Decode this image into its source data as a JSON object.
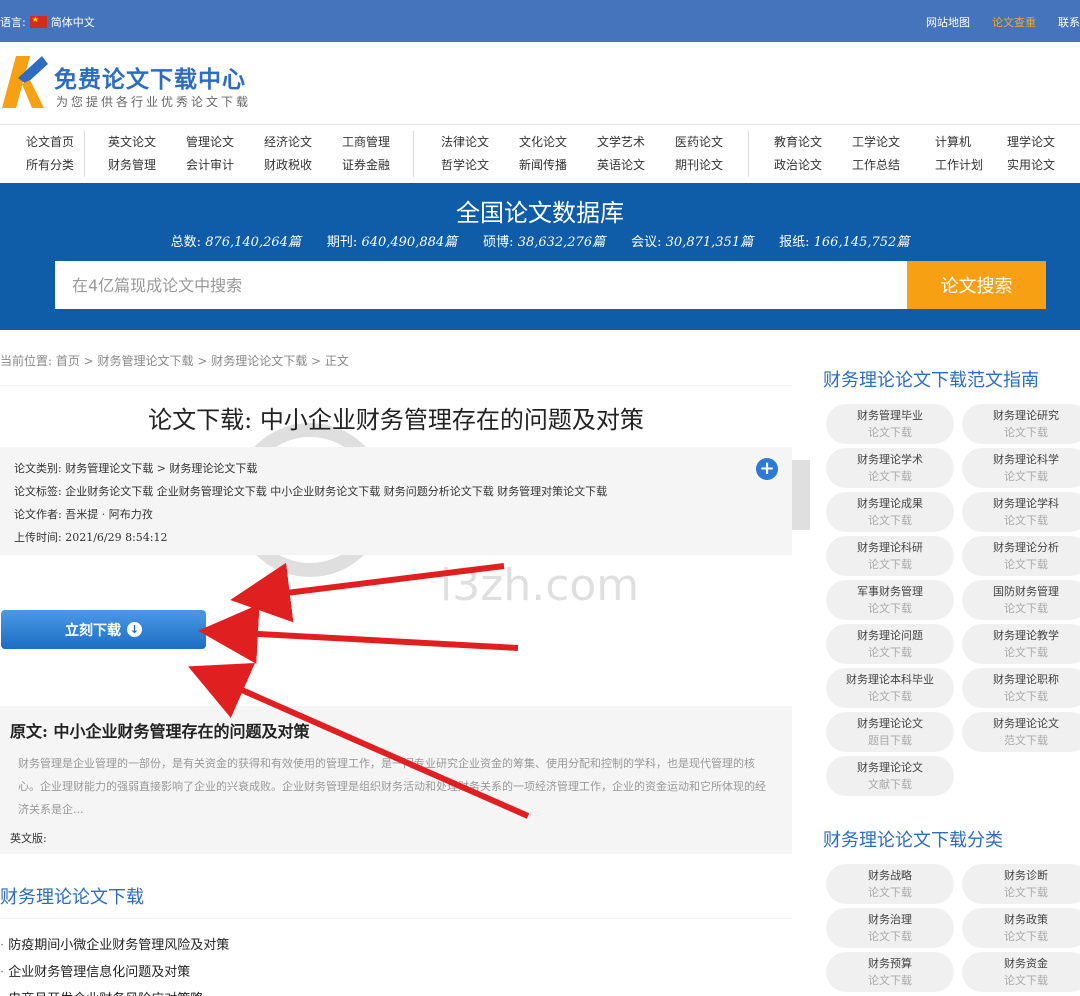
{
  "topbar": {
    "language_label": "语言:",
    "language_value": "简体中文",
    "links": [
      "网站地图",
      "论文查重",
      "联系"
    ]
  },
  "logo": {
    "title": "免费论文下载中心",
    "subtitle": "为您提供各行业优秀论文下载"
  },
  "categories": {
    "row1": [
      "论文首页",
      "英文论文",
      "管理论文",
      "经济论文",
      "工商管理",
      "法律论文",
      "文化论文",
      "文学艺术",
      "医药论文",
      "教育论文",
      "工学论文",
      "计算机",
      "理学论文"
    ],
    "row2": [
      "所有分类",
      "财务管理",
      "会计审计",
      "财政税收",
      "证券金融",
      "哲学论文",
      "新闻传播",
      "英语论文",
      "期刊论文",
      "政治论文",
      "工作总结",
      "工作计划",
      "实用论文"
    ]
  },
  "database": {
    "title": "全国论文数据库",
    "stats": [
      {
        "label": "总数:",
        "value": "876,140,264篇"
      },
      {
        "label": "期刊:",
        "value": "640,490,884篇"
      },
      {
        "label": "硕博:",
        "value": "38,632,276篇"
      },
      {
        "label": "会议:",
        "value": "30,871,351篇"
      },
      {
        "label": "报纸:",
        "value": "166,145,752篇"
      }
    ],
    "search_placeholder": "在4亿篇现成论文中搜索",
    "search_button": "论文搜索"
  },
  "breadcrumb": "当前位置: 首页 > 财务管理论文下载 > 财务理论论文下载 > 正文",
  "article": {
    "title": "论文下载: 中小企业财务管理存在的问题及对策",
    "category": "论文类别: 财务管理论文下载 > 财务理论论文下载",
    "tags": "论文标签: 企业财务论文下载 企业财务管理论文下载 中小企业财务论文下载 财务问题分析论文下载 财务管理对策论文下载",
    "author": "论文作者: 吾米提 · 阿布力孜",
    "upload_time": "上传时间: 2021/6/29 8:54:12",
    "download_button": "立刻下载",
    "original_title": "原文: 中小企业财务管理存在的问题及对策",
    "original_body": "财务管理是企业管理的一部份，是有关资金的获得和有效使用的管理工作，是一门专业研究企业资金的筹集、使用分配和控制的学科，也是现代管理的核心。企业理财能力的强弱直接影响了企业的兴衰成败。企业财务管理是组织财务活动和处理财务关系的一项经济管理工作，企业的资金运动和它所体现的经济关系是企...",
    "english_label": "英文版:"
  },
  "related": {
    "title": "财务理论论文下载",
    "items": [
      "防疫期间小微企业财务管理风险及对策",
      "企业财务管理信息化问题及对策",
      "电商月开发企业财务风险应对策略"
    ]
  },
  "sidebar": {
    "guide_title": "财务理论论文下载范文指南",
    "guide_tags": [
      {
        "a": "财务管理毕业",
        "b": "论文下载"
      },
      {
        "a": "财务理论研究",
        "b": "论文下载"
      },
      {
        "a": "财务理论学术",
        "b": "论文下载"
      },
      {
        "a": "财务理论科学",
        "b": "论文下载"
      },
      {
        "a": "财务理论成果",
        "b": "论文下载"
      },
      {
        "a": "财务理论学科",
        "b": "论文下载"
      },
      {
        "a": "财务理论科研",
        "b": "论文下载"
      },
      {
        "a": "财务理论分析",
        "b": "论文下载"
      },
      {
        "a": "军事财务管理",
        "b": "论文下载"
      },
      {
        "a": "国防财务管理",
        "b": "论文下载"
      },
      {
        "a": "财务理论问题",
        "b": "论文下载"
      },
      {
        "a": "财务理论教学",
        "b": "论文下载"
      },
      {
        "a": "财务理论本科毕业",
        "b": "论文下载"
      },
      {
        "a": "财务理论职称",
        "b": "论文下载"
      },
      {
        "a": "财务理论论文",
        "b": "题目下载"
      },
      {
        "a": "财务理论论文",
        "b": "范文下载"
      },
      {
        "a": "财务理论论文",
        "b": "文献下载"
      }
    ],
    "class_title": "财务理论论文下载分类",
    "class_tags": [
      {
        "a": "财务战略",
        "b": "论文下载"
      },
      {
        "a": "财务诊断",
        "b": "论文下载"
      },
      {
        "a": "财务治理",
        "b": "论文下载"
      },
      {
        "a": "财务政策",
        "b": "论文下载"
      },
      {
        "a": "财务预算",
        "b": "论文下载"
      },
      {
        "a": "财务资金",
        "b": "论文下载"
      }
    ]
  },
  "watermark": {
    "text": "i3zh.com"
  },
  "colors": {
    "topbar": "#4574bd",
    "banner": "#0f5ca8",
    "accent": "#f8a013",
    "link": "#2d6cc0",
    "arrow": "#e02020"
  }
}
